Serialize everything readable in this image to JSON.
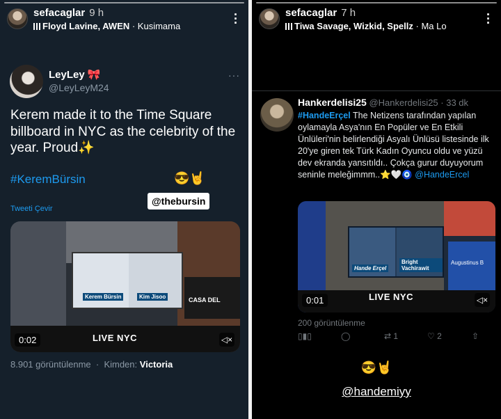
{
  "left_story": {
    "username": "sefacaglar",
    "time": "9 h",
    "music_artists": "Floyd Lavine, AWEN",
    "music_separator": "·",
    "music_track": "Kusimama",
    "tweet": {
      "display_name": "LeyLey",
      "name_emoji": "🎀",
      "handle": "@LeyLeyM24",
      "more": "···",
      "text": "Kerem made it to the Time Square billboard in NYC as the celebrity of the year. Proud✨",
      "hashtag": "#KeremBürsin",
      "translate": "Tweeti Çevir",
      "video_time": "0:02",
      "views": "8.901 görüntülenme",
      "from_label": "Kimden:",
      "from_value": "Victoria",
      "billboard_left_name": "Kerem Bürsin",
      "billboard_right_name": "Kim Jisoo",
      "casa_sign": "CASA DEL",
      "live_sign": "LIVE NYC"
    },
    "sticker_emoji": "😎🤘",
    "mention_sticker": "@thebursin"
  },
  "right_story": {
    "username": "sefacaglar",
    "time": "7 h",
    "music_artists": "Tiwa Savage, Wizkid, Spellz",
    "music_separator": "·",
    "music_track": "Ma Lo",
    "tweet": {
      "display_name": "Hankerdelisi25",
      "handle": "@Hankerdelisi25",
      "age": "· 33 dk",
      "more": "···",
      "hashtag": "#HandeErçel",
      "text": " The Netizens tarafından yapılan oylamayla Asya'nın En Popüler ve En Etkili Ünlüleri'nin belirlendiği Asyalı Ünlüsü listesinde ilk 20'ye giren tek Türk Kadın Oyuncu oldu ve yüzü dev ekranda yansıtıldı.. Çokça gurur duyuyorum seninle meleğimmm..⭐🤍🧿 ",
      "mention": "@HandeErcel",
      "video_time": "0:01",
      "views": "200 görüntülenme",
      "retweets": "1",
      "likes": "2",
      "billboard_left_name": "Hande Erçel",
      "billboard_right_name": "Bright Vachirawit",
      "ab_sign": "Augustinus B",
      "live_sign": "LIVE NYC"
    },
    "sticker_emoji": "😎🤘",
    "mention_sticker": "@handemiyy"
  }
}
